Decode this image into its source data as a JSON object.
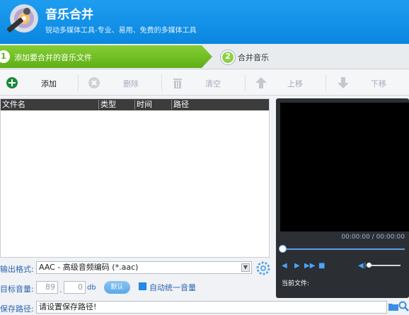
{
  "app": {
    "title": "音乐合并",
    "subtitle": "锐动多媒体工具-专业、易用、免费的多媒体工具"
  },
  "steps": [
    {
      "number": "1",
      "label": "添加要合并的音乐文件",
      "active": true
    },
    {
      "number": "2",
      "label": "合并音乐",
      "active": false
    }
  ],
  "toolbar": {
    "add": "添加",
    "delete": "删除",
    "clear": "清空",
    "move_up": "上移",
    "move_down": "下移"
  },
  "filelist": {
    "columns": [
      "文件名",
      "类型",
      "时间",
      "路径"
    ],
    "rows": []
  },
  "player": {
    "timecode": "00:00:00 / 00:00:00",
    "current_file_label": "当前文件:"
  },
  "settings": {
    "format_label": "输出格式:",
    "format_value": "AAC - 高级音频编码 (*.aac)",
    "volume_label": "目标音量:",
    "volume_int": "89",
    "volume_dec": "0",
    "volume_unit": "db",
    "default_button": "默认",
    "auto_volume_label": "自动统一音量",
    "path_label": "保存路径:",
    "path_value": "请设置保存路径!"
  },
  "colors": {
    "header": "#0a86e0",
    "step_active": "#5fae16",
    "label_blue": "#2a64b4"
  }
}
